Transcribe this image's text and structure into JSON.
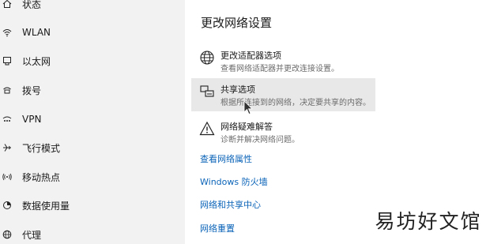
{
  "sidebar": {
    "items": [
      {
        "label": "状态",
        "icon": "home-icon"
      },
      {
        "label": "WLAN",
        "icon": "wifi-icon"
      },
      {
        "label": "以太网",
        "icon": "ethernet-icon"
      },
      {
        "label": "拨号",
        "icon": "dialup-icon"
      },
      {
        "label": "VPN",
        "icon": "vpn-icon"
      },
      {
        "label": "飞行模式",
        "icon": "airplane-icon"
      },
      {
        "label": "移动热点",
        "icon": "hotspot-icon"
      },
      {
        "label": "数据使用量",
        "icon": "data-usage-icon"
      },
      {
        "label": "代理",
        "icon": "globe-icon"
      }
    ]
  },
  "main": {
    "title": "更改网络设置",
    "options": [
      {
        "title": "更改适配器选项",
        "desc": "查看网络适配器并更改连接设置。",
        "icon": "adapter-globe-icon",
        "highlighted": false
      },
      {
        "title": "共享选项",
        "desc": "根据所连接到的网络，决定要共享的内容。",
        "icon": "sharing-printer-icon",
        "highlighted": true
      },
      {
        "title": "网络疑难解答",
        "desc": "诊断并解决网络问题。",
        "icon": "warning-icon",
        "highlighted": false
      }
    ],
    "links": [
      "查看网络属性",
      "Windows 防火墙",
      "网络和共享中心",
      "网络重置"
    ]
  },
  "colors": {
    "sidebar_bg": "#f2f2f2",
    "link": "#0a63b8",
    "hover_bg": "#e8e8e8",
    "desc_text": "#6b6b6b"
  },
  "watermark": {
    "text": "易坊好文馆"
  }
}
